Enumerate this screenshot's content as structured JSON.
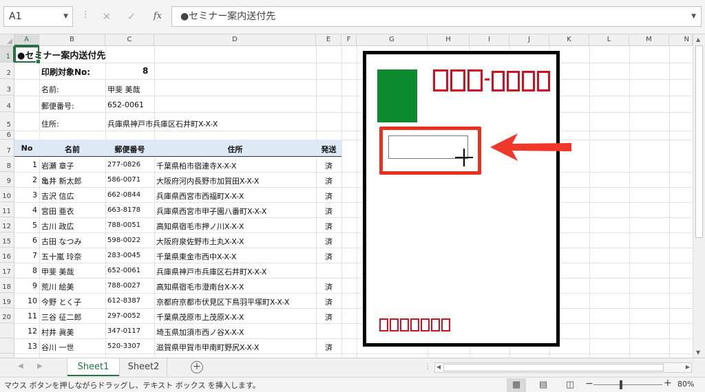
{
  "formula_bar": {
    "name_box": "A1",
    "cancel_icon": "✕",
    "enter_icon": "✓",
    "fx_label": "fx",
    "formula": "●セミナー案内送付先"
  },
  "columns": [
    "A",
    "B",
    "C",
    "D",
    "E",
    "F",
    "G",
    "H",
    "I",
    "J",
    "K",
    "L",
    "M",
    "N"
  ],
  "rows": [
    "1",
    "2",
    "3",
    "4",
    "5",
    "6",
    "7",
    "8",
    "9",
    "10",
    "11",
    "12",
    "15",
    "16",
    "17",
    "18",
    "19",
    "20"
  ],
  "info": {
    "title": "●セミナー案内送付先",
    "print_label": "印刷対象No:",
    "print_value": "8",
    "name_label": "名前:",
    "name_value": "甲斐 美哉",
    "zip_label": "郵便番号:",
    "zip_value": "652-0061",
    "address_label": "住所:",
    "address_value": "兵庫県神戸市兵庫区石井町X-X-X"
  },
  "table": {
    "headers": [
      "No",
      "名前",
      "郵便番号",
      "住所",
      "発送"
    ],
    "rows": [
      [
        "1",
        "岩瀬 章子",
        "277-0826",
        "千葉県柏市宿連寺X-X-X",
        "済"
      ],
      [
        "2",
        "亀井 新太郎",
        "586-0071",
        "大阪府河内長野市加賀田X-X-X",
        "済"
      ],
      [
        "3",
        "吉沢 信広",
        "662-0844",
        "兵庫県西宮市西福町X-X-X",
        "済"
      ],
      [
        "4",
        "宮田 亜衣",
        "663-8178",
        "兵庫県西宮市甲子園八番町X-X-X",
        "済"
      ],
      [
        "5",
        "古川 政広",
        "788-0051",
        "高知県宿毛市押ノ川X-X-X",
        "済"
      ],
      [
        "6",
        "古田 なつみ",
        "598-0022",
        "大阪府泉佐野市土丸X-X-X",
        "済"
      ],
      [
        "7",
        "五十嵐 玲奈",
        "283-0045",
        "千葉県東金市西中X-X-X",
        "済"
      ],
      [
        "8",
        "甲斐 美哉",
        "652-0061",
        "兵庫県神戸市兵庫区石井町X-X-X",
        ""
      ],
      [
        "9",
        "荒川 絵美",
        "788-0027",
        "高知県宿毛市澄南台X-X-X",
        "済"
      ],
      [
        "10",
        "今野 とく子",
        "612-8387",
        "京都府京都市伏見区下鳥羽平塚町X-X-X",
        "済"
      ],
      [
        "11",
        "三谷 征二郎",
        "297-0052",
        "千葉県茂原市上茂原X-X-X",
        "済"
      ],
      [
        "12",
        "村井 眞美",
        "347-0117",
        "埼玉県加須市西ノ谷X-X-X",
        ""
      ],
      [
        "13",
        "谷川 一世",
        "520-3307",
        "滋賀県甲賀市甲南町野尻X-X-X",
        "済"
      ]
    ]
  },
  "postcard": {
    "stamp_color": "#0c8a2e",
    "box_color": "#d10f1f",
    "highlight_color": "#e8301f"
  },
  "tabs": [
    "Sheet1",
    "Sheet2"
  ],
  "add_sheet_icon": "+",
  "status": {
    "message": "マウス ボタンを押しながらドラッグし、テキスト ボックス を挿入します。",
    "zoom_minus": "−",
    "zoom_plus": "+",
    "zoom": "80%",
    "zoom_fraction": 0.4
  }
}
